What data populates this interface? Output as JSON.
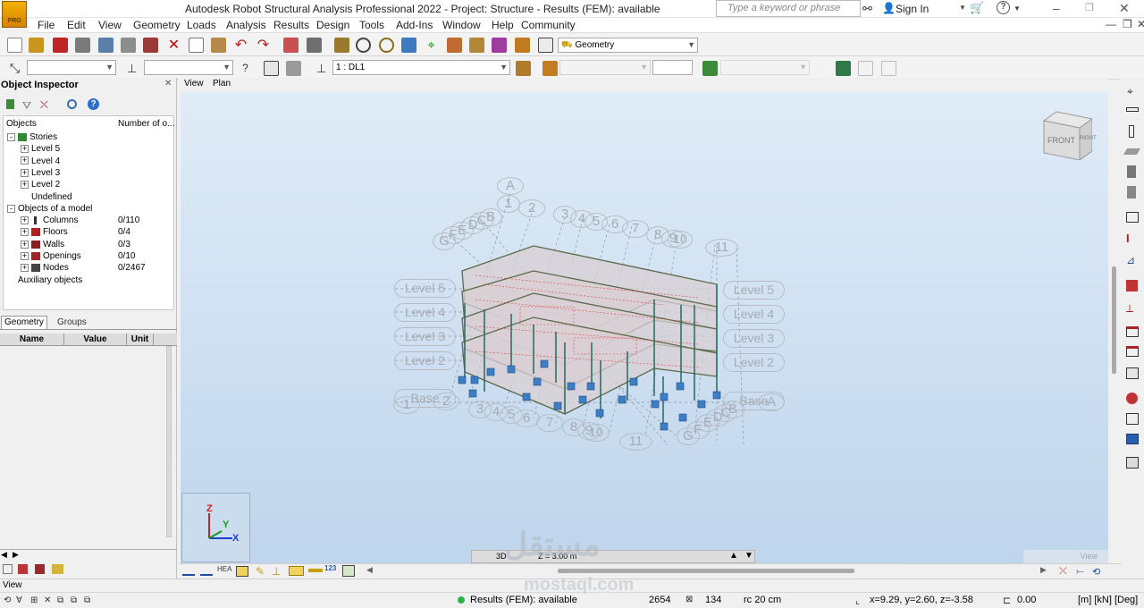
{
  "app": {
    "title": "Autodesk Robot Structural Analysis Professional 2022 - Project: Structure - Results (FEM): available",
    "logo_text": "PRO",
    "search_placeholder": "Type a keyword or phrase",
    "sign_in": "Sign In"
  },
  "menu": [
    "File",
    "Edit",
    "View",
    "Geometry",
    "Loads",
    "Analysis",
    "Results",
    "Design",
    "Tools",
    "Add-Ins",
    "Window",
    "Help",
    "Community"
  ],
  "toolbar": {
    "layout_select": "Geometry",
    "load_case_select": "1 : DL1"
  },
  "inspector": {
    "title": "Object Inspector",
    "col_objects": "Objects",
    "col_number": "Number of o...",
    "tree": [
      {
        "label": "Stories",
        "level": 0,
        "expander": "-",
        "icon": "stories-icon",
        "count": ""
      },
      {
        "label": "Level 5",
        "level": 1,
        "expander": "+",
        "icon": "",
        "count": ""
      },
      {
        "label": "Level 4",
        "level": 1,
        "expander": "+",
        "icon": "",
        "count": ""
      },
      {
        "label": "Level 3",
        "level": 1,
        "expander": "+",
        "icon": "",
        "count": ""
      },
      {
        "label": "Level 2",
        "level": 1,
        "expander": "+",
        "icon": "",
        "count": ""
      },
      {
        "label": "Undefined",
        "level": 1,
        "expander": "",
        "icon": "",
        "count": ""
      },
      {
        "label": "Objects of a model",
        "level": 0,
        "expander": "-",
        "icon": "",
        "count": ""
      },
      {
        "label": "Columns",
        "level": 1,
        "expander": "+",
        "icon": "column-icon",
        "count": "0/110"
      },
      {
        "label": "Floors",
        "level": 1,
        "expander": "+",
        "icon": "floor-icon",
        "count": "0/4"
      },
      {
        "label": "Walls",
        "level": 1,
        "expander": "+",
        "icon": "wall-icon",
        "count": "0/3"
      },
      {
        "label": "Openings",
        "level": 1,
        "expander": "+",
        "icon": "opening-icon",
        "count": "0/10"
      },
      {
        "label": "Nodes",
        "level": 1,
        "expander": "+",
        "icon": "node-icon",
        "count": "0/2467"
      },
      {
        "label": "Auxiliary objects",
        "level": 0,
        "expander": "",
        "icon": "",
        "count": ""
      }
    ],
    "tabs": [
      "Geometry",
      "Groups"
    ],
    "prop_headers": [
      "Name",
      "Value",
      "Unit"
    ]
  },
  "view": {
    "tabs": [
      "View",
      "Plan"
    ],
    "cube_front": "FRONT",
    "cube_right": "RIGHT",
    "axis_labels": [
      "Z",
      "Y",
      "X"
    ],
    "mode_3d": "3D",
    "z_level": "Z = 3.00 m",
    "view_label": "View",
    "grid_top_letters": [
      "A",
      "B",
      "C",
      "D",
      "E",
      "F",
      "G"
    ],
    "grid_top_numbers": [
      "1",
      "2",
      "3",
      "4",
      "5",
      "6",
      "7",
      "8",
      "9",
      "10",
      "11"
    ],
    "grid_bottom_numbers": [
      "1",
      "2",
      "3",
      "4",
      "5",
      "6",
      "7",
      "8",
      "9",
      "10",
      "11"
    ],
    "grid_bottom_letters": [
      "A",
      "B",
      "C",
      "D",
      "E",
      "F",
      "G"
    ],
    "levels_left": [
      "Level 5",
      "Level 4",
      "Level 3",
      "Level 2",
      "Base"
    ],
    "levels_right": [
      "Level 5",
      "Level 4",
      "Level 3",
      "Level 2",
      "Base"
    ],
    "watermark_main": "مستقل",
    "watermark_sub": "mostaql.com"
  },
  "status": {
    "view_tab": "View",
    "results": "Results (FEM): available",
    "nodes": "2654",
    "bars": "134",
    "section": "rc 20 cm",
    "coords": "x=9.29, y=2.60, z=-3.58",
    "angle": "0.00",
    "units": "[m] [kN] [Deg]",
    "result_color": "#2db34a"
  }
}
